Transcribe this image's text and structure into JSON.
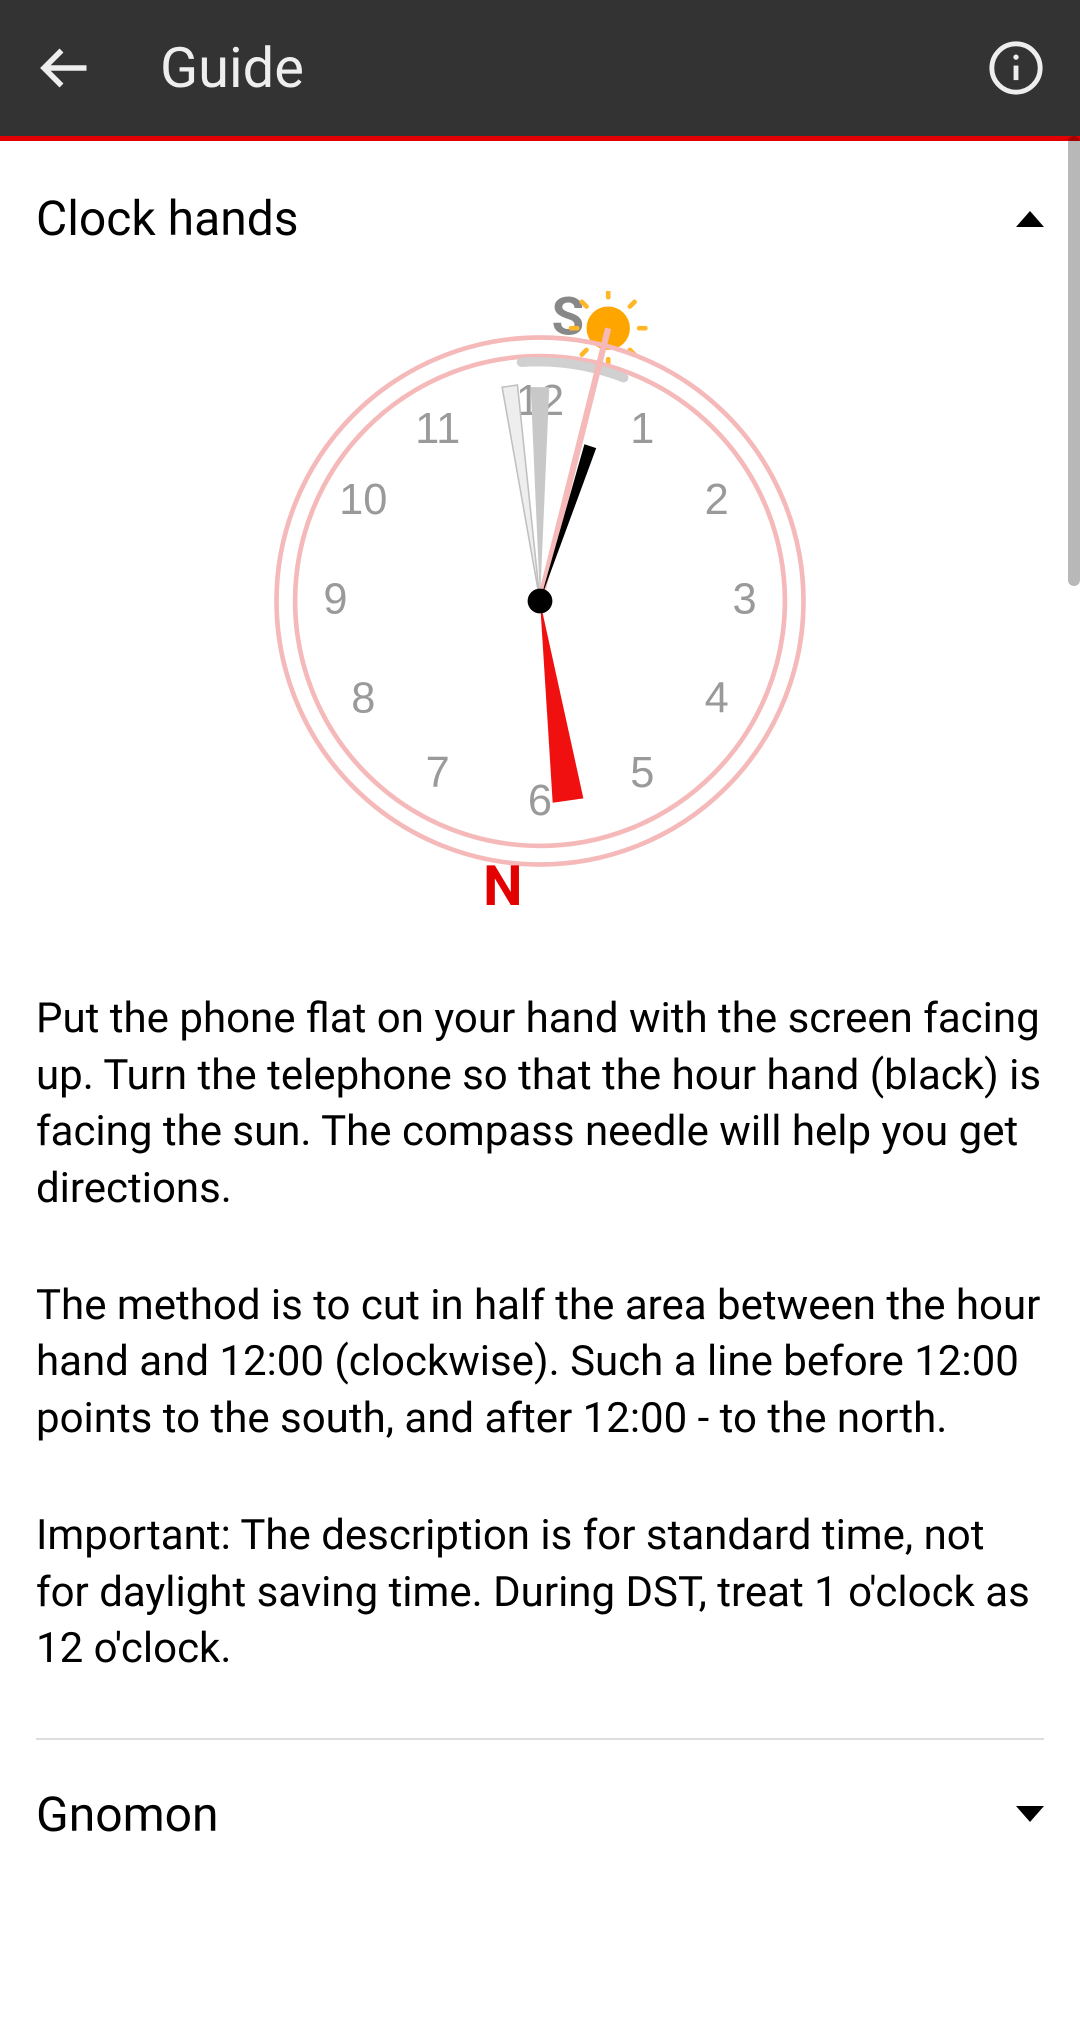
{
  "header": {
    "title": "Guide"
  },
  "sections": {
    "clockhands": {
      "title": "Clock hands",
      "diagram": {
        "south_label": "S",
        "north_label": "N",
        "numbers": [
          "12",
          "1",
          "2",
          "3",
          "4",
          "5",
          "6",
          "7",
          "8",
          "9",
          "10",
          "11"
        ]
      },
      "paragraphs": [
        "Put the phone flat on your hand with the screen facing up. Turn the telephone so that the hour hand (black) is facing the sun. The compass needle will help you get directions.",
        "The method is to cut in half the area between the hour hand and 12:00 (clockwise). Such a line before 12:00 points to the south, and after 12:00 - to the north.",
        "Important: The description is for standard time, not for daylight saving time. During DST, treat 1 o'clock as 12 o'clock."
      ]
    },
    "gnomon": {
      "title": "Gnomon"
    }
  },
  "colors": {
    "accent": "#e20000",
    "header_bg": "#333333",
    "clock_ring": "#f5b9b9",
    "needle_red": "#f01010",
    "sun": "#ffa500"
  }
}
